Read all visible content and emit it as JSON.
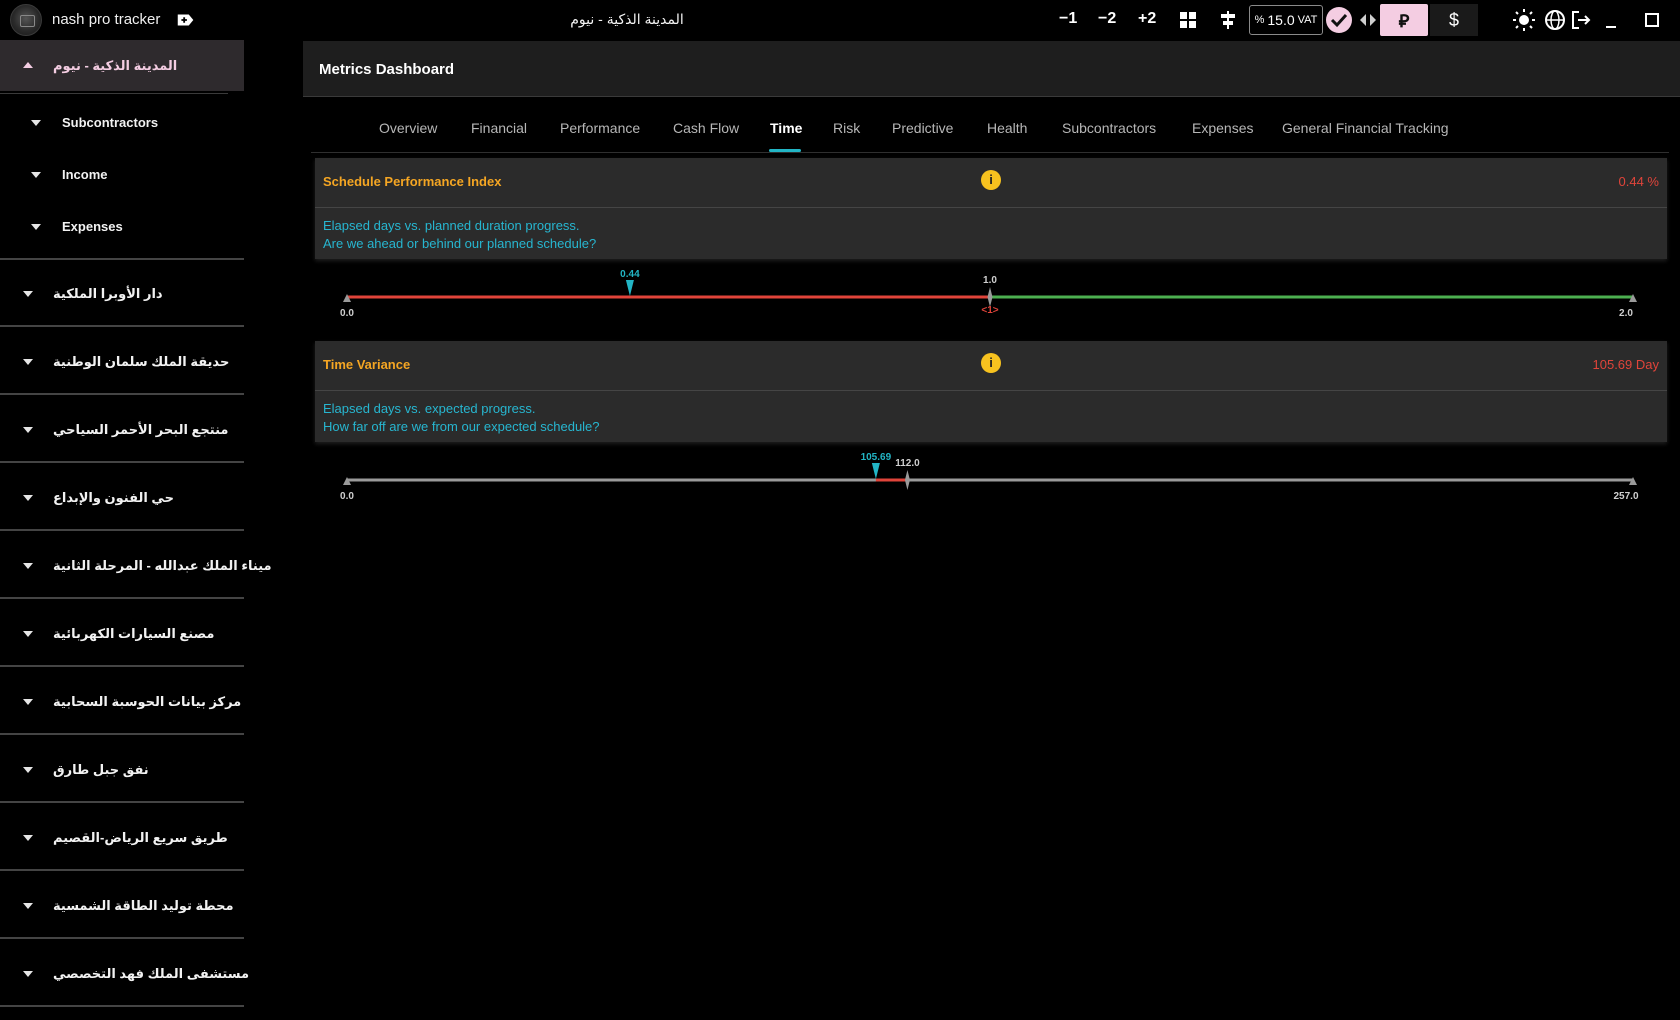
{
  "app": {
    "title": "nash pro tracker",
    "project_title": "المدينة الذكية - نيوم"
  },
  "toolbar": {
    "minus1": "−1",
    "minus2": "−2",
    "plus2": "+2",
    "vat_percent": "%",
    "vat_value": "15.0",
    "vat_label": "VAT",
    "currency_sar": "⃁",
    "currency_usd": "$"
  },
  "sidebar": {
    "active_project": "المدينة الذكية - نيوم",
    "sub_items": [
      "Subcontractors",
      "Income",
      "Expenses"
    ],
    "projects": [
      "دار الأوبرا الملكية",
      "حديقة الملك سلمان الوطنية",
      "منتجع البحر الأحمر السياحي",
      "حي الفنون والإبداع",
      "ميناء الملك عبدالله - المرحلة الثانية",
      "مصنع السيارات الكهربائية",
      "مركز بيانات الحوسبة السحابية",
      "نفق جبل طارق",
      "طريق سريع الرياض-القصيم",
      "محطة توليد الطاقة الشمسية",
      "مستشفى الملك فهد التخصصي"
    ]
  },
  "main": {
    "title": "Metrics Dashboard",
    "tabs": [
      "Overview",
      "Financial",
      "Performance",
      "Cash Flow",
      "Time",
      "Risk",
      "Predictive",
      "Health",
      "Subcontractors",
      "Expenses",
      "General Financial Tracking"
    ],
    "active_tab": "Time"
  },
  "metrics": [
    {
      "title": "Schedule Performance Index",
      "value": "0.44 %",
      "desc1": "Elapsed days vs. planned duration progress.",
      "desc2": "Are we ahead or behind our planned schedule?",
      "gauge": {
        "min": 0.0,
        "max": 2.0,
        "value": 0.44,
        "target": 1.0,
        "min_label": "0.0",
        "max_label": "2.0",
        "value_label": "0.44",
        "target_label": "1.0",
        "target_note": "<1>",
        "below_color": "#e0443a",
        "above_color": "#4caf50"
      }
    },
    {
      "title": "Time Variance",
      "value": "105.69 Day",
      "desc1": "Elapsed days vs. expected progress.",
      "desc2": "How far off are we from our expected schedule?",
      "gauge": {
        "min": 0.0,
        "max": 257.0,
        "value": 105.69,
        "target": 112.0,
        "min_label": "0.0",
        "max_label": "257.0",
        "value_label": "105.69",
        "target_label": "112.0",
        "track_color": "#9a9a9a",
        "highlight_color": "#e0443a"
      }
    }
  ],
  "colors": {
    "accent": "#22b5c5",
    "highlight": "#f4cde2",
    "title_orange": "#f5a623",
    "negative": "#e0443a",
    "positive": "#4caf50"
  }
}
